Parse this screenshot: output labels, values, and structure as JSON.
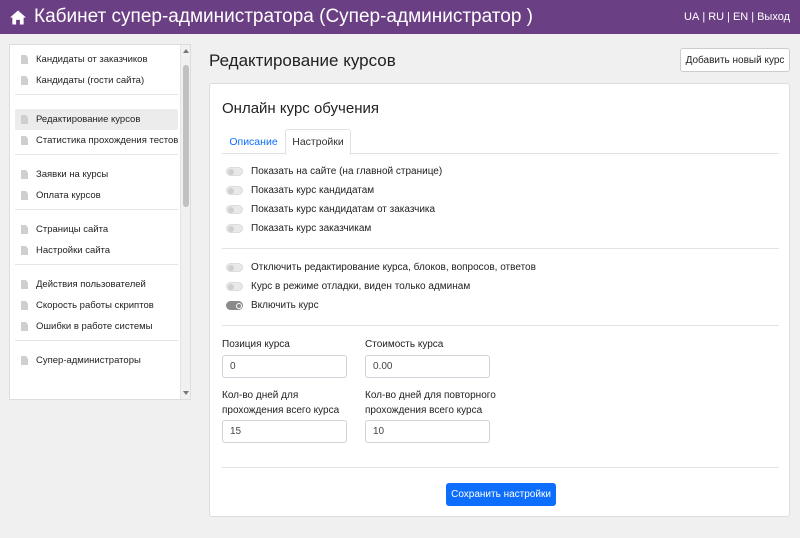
{
  "header": {
    "title": "Кабинет супер-администратора (Супер-администратор )",
    "langs": [
      "UA",
      "|",
      "RU",
      "|",
      "EN",
      "|",
      "Выход"
    ]
  },
  "sidebar": {
    "groups": [
      [
        "Кандидаты от заказчиков",
        "Кандидаты (гости сайта)"
      ],
      [
        "Редактирование курсов",
        "Статистика прохождения тестов"
      ],
      [
        "Заявки на курсы",
        "Оплата курсов"
      ],
      [
        "Страницы сайта",
        "Настройки сайта"
      ],
      [
        "Действия пользователей",
        "Скорость работы скриптов",
        "Ошибки в работе системы"
      ],
      [
        "Супер-администраторы"
      ]
    ],
    "active": "Редактирование курсов"
  },
  "main": {
    "page_title": "Редактирование курсов",
    "add_button": "Добавить новый курс",
    "card_title": "Онлайн курс обучения",
    "tabs": [
      "Описание",
      "Настройки"
    ],
    "switches_group1": [
      {
        "label": "Показать на сайте (на главной странице)",
        "on": false
      },
      {
        "label": "Показать курс кандидатам",
        "on": false
      },
      {
        "label": "Показать курс кандидатам от заказчика",
        "on": false
      },
      {
        "label": "Показать курс заказчикам",
        "on": false
      }
    ],
    "switches_group2": [
      {
        "label": "Отключить редактирование курса, блоков, вопросов, ответов",
        "on": false
      },
      {
        "label": "Курс в режиме отладки, виден только админам",
        "on": false
      },
      {
        "label": "Включить курс",
        "on": true
      }
    ],
    "fields": {
      "position_label": "Позиция курса",
      "position_value": "0",
      "price_label": "Стоимость курса",
      "price_value": "0.00",
      "days_label_1": "Кол-во дней для",
      "days_label_2": "прохождения всего курса",
      "days_value": "15",
      "repeat_label_1": "Кол-во дней для повторного",
      "repeat_label_2": "прохождения всего курса",
      "repeat_value": "10"
    },
    "save_button": "Сохранить настройки"
  },
  "colors": {
    "header_bg": "#6b3f84",
    "primary": "#0d6efd"
  },
  "icons": {
    "home": "home-icon",
    "doc": "document-icon"
  }
}
